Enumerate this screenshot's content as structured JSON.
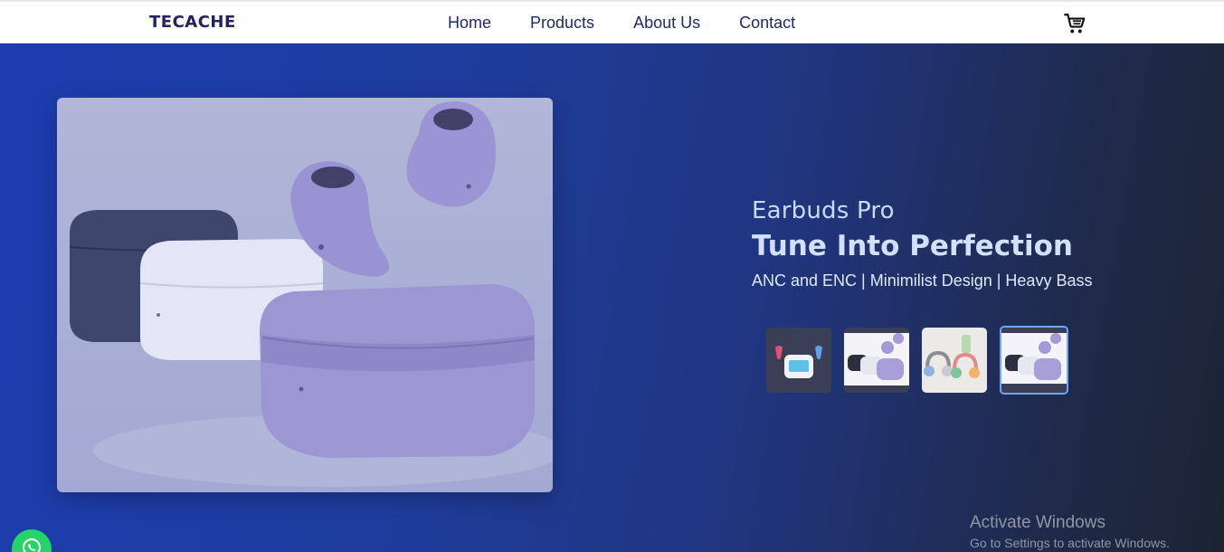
{
  "header": {
    "logo": "TECACHE",
    "nav": [
      "Home",
      "Products",
      "About Us",
      "Contact"
    ],
    "cart_icon": "shopping-cart-icon"
  },
  "hero": {
    "subtitle": "Earbuds Pro",
    "headline": "Tune Into Perfection",
    "features": "ANC and ENC | Minimilist Design | Heavy Bass",
    "main_image": "lavender-earbuds-and-cases-photo",
    "thumbnails": [
      {
        "name": "smart-display-earbuds-thumbnail",
        "active": false
      },
      {
        "name": "lavender-earbuds-thumbnail",
        "active": false
      },
      {
        "name": "colorful-headphones-thumbnail",
        "active": false
      },
      {
        "name": "lavender-earbuds-thumbnail-selected",
        "active": true
      }
    ]
  },
  "overlay": {
    "title": "Activate Windows",
    "subtitle": "Go to Settings to activate Windows."
  },
  "colors": {
    "brand_text": "#22235e",
    "nav_text": "#1f2a6b",
    "hero_start": "#1d3db0",
    "hero_end": "#1c2433",
    "whatsapp": "#25d366"
  }
}
